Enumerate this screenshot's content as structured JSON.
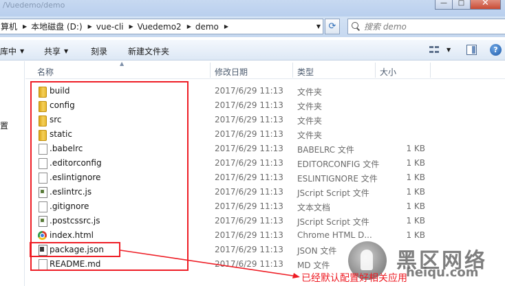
{
  "window": {
    "title_fragment": "/Vuedemo/demo",
    "controls": {
      "minimize": "—",
      "maximize": "□",
      "close": "✕"
    }
  },
  "address": {
    "crumbs": [
      "算机",
      "本地磁盘 (D:)",
      "vue-cli",
      "Vuedemo2",
      "demo"
    ],
    "search_placeholder": "搜索 demo"
  },
  "toolbar": {
    "library": "库中",
    "share": "共享",
    "burn": "刻录",
    "new_folder": "新建文件夹"
  },
  "nav": {
    "fragment": "置"
  },
  "columns": {
    "name": "名称",
    "date": "修改日期",
    "type": "类型",
    "size": "大小"
  },
  "files": [
    {
      "name": "build",
      "date": "2017/6/29 11:13",
      "type": "文件夹",
      "size": "",
      "icon": "folder"
    },
    {
      "name": "config",
      "date": "2017/6/29 11:13",
      "type": "文件夹",
      "size": "",
      "icon": "folder"
    },
    {
      "name": "src",
      "date": "2017/6/29 11:13",
      "type": "文件夹",
      "size": "",
      "icon": "folder"
    },
    {
      "name": "static",
      "date": "2017/6/29 11:13",
      "type": "文件夹",
      "size": "",
      "icon": "folder"
    },
    {
      "name": ".babelrc",
      "date": "2017/6/29 11:13",
      "type": "BABELRC 文件",
      "size": "1 KB",
      "icon": "doc"
    },
    {
      "name": ".editorconfig",
      "date": "2017/6/29 11:13",
      "type": "EDITORCONFIG 文件",
      "size": "1 KB",
      "icon": "doc"
    },
    {
      "name": ".eslintignore",
      "date": "2017/6/29 11:13",
      "type": "ESLINTIGNORE 文件",
      "size": "1 KB",
      "icon": "doc"
    },
    {
      "name": ".eslintrc.js",
      "date": "2017/6/29 11:13",
      "type": "JScript Script 文件",
      "size": "1 KB",
      "icon": "js"
    },
    {
      "name": ".gitignore",
      "date": "2017/6/29 11:13",
      "type": "文本文档",
      "size": "1 KB",
      "icon": "doc"
    },
    {
      "name": ".postcssrc.js",
      "date": "2017/6/29 11:13",
      "type": "JScript Script 文件",
      "size": "1 KB",
      "icon": "js"
    },
    {
      "name": "index.html",
      "date": "2017/6/29 11:13",
      "type": "Chrome HTML D...",
      "size": "1 KB",
      "icon": "chrome"
    },
    {
      "name": "package.json",
      "date": "2017/6/29 11:13",
      "type": "JSON 文件",
      "size": "",
      "icon": "pkg"
    },
    {
      "name": "README.md",
      "date": "2017/6/29 11:13",
      "type": "MD 文件",
      "size": "",
      "icon": "doc"
    }
  ],
  "annotation": {
    "text": "已经默认配置好相关应用",
    "color": "#ee1c24"
  },
  "watermark": {
    "brand": "黑区网络",
    "url": "heiqu.com"
  }
}
